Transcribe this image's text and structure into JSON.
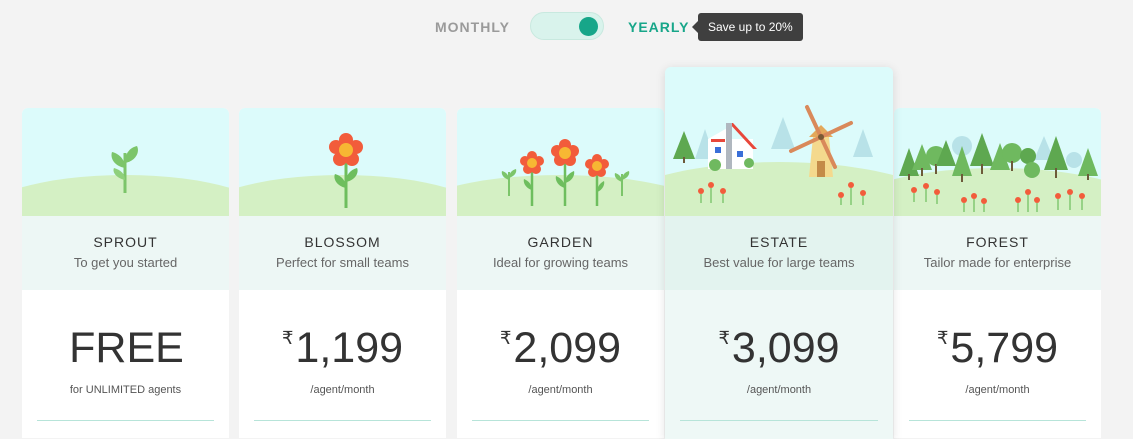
{
  "billing_toggle": {
    "monthly_label": "MONTHLY",
    "yearly_label": "YEARLY",
    "selected": "yearly",
    "tooltip": "Save up to 20%"
  },
  "plans": [
    {
      "name": "SPROUT",
      "tagline": "To get you started",
      "currency": "",
      "price": "FREE",
      "unit": "for UNLIMITED agents",
      "illustration": "sprout"
    },
    {
      "name": "BLOSSOM",
      "tagline": "Perfect for small teams",
      "currency": "₹",
      "price": "1,199",
      "unit": "/agent/month",
      "illustration": "flower"
    },
    {
      "name": "GARDEN",
      "tagline": "Ideal for growing teams",
      "currency": "₹",
      "price": "2,099",
      "unit": "/agent/month",
      "illustration": "flower-garden"
    },
    {
      "name": "ESTATE",
      "tagline": "Best value for large teams",
      "currency": "₹",
      "price": "3,099",
      "unit": "/agent/month",
      "illustration": "house-windmill",
      "featured": true
    },
    {
      "name": "FOREST",
      "tagline": "Tailor made for enterprise",
      "currency": "₹",
      "price": "5,799",
      "unit": "/agent/month",
      "illustration": "forest"
    }
  ],
  "colors": {
    "accent": "#17a689",
    "background": "#f3f3f3",
    "sky": "#dcfbfb",
    "hill": "#d4f0c4",
    "tooltip_bg": "#3f3f3f"
  }
}
